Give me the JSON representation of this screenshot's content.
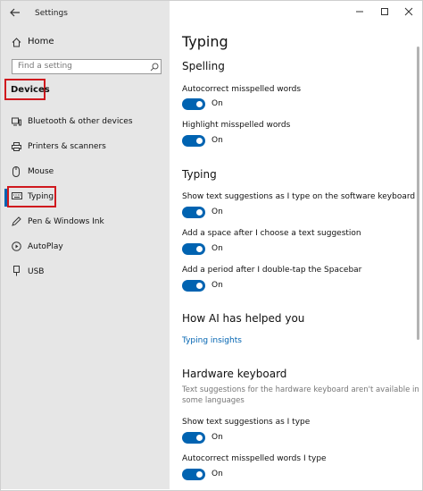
{
  "window": {
    "title": "Settings"
  },
  "sidebar": {
    "home_label": "Home",
    "search_placeholder": "Find a setting",
    "section_title": "Devices",
    "items": [
      {
        "label": "Bluetooth & other devices",
        "icon": "bluetooth-devices-icon"
      },
      {
        "label": "Printers & scanners",
        "icon": "printer-icon"
      },
      {
        "label": "Mouse",
        "icon": "mouse-icon"
      },
      {
        "label": "Typing",
        "icon": "keyboard-icon",
        "selected": true
      },
      {
        "label": "Pen & Windows Ink",
        "icon": "pen-icon"
      },
      {
        "label": "AutoPlay",
        "icon": "autoplay-icon"
      },
      {
        "label": "USB",
        "icon": "usb-icon"
      }
    ]
  },
  "main": {
    "page_title": "Typing",
    "spelling": {
      "heading": "Spelling",
      "autocorrect": {
        "label": "Autocorrect misspelled words",
        "state": "On"
      },
      "highlight": {
        "label": "Highlight misspelled words",
        "state": "On"
      }
    },
    "typing": {
      "heading": "Typing",
      "suggestions": {
        "label": "Show text suggestions as I type on the software keyboard",
        "state": "On"
      },
      "space": {
        "label": "Add a space after I choose a text suggestion",
        "state": "On"
      },
      "period": {
        "label": "Add a period after I double-tap the Spacebar",
        "state": "On"
      }
    },
    "ai": {
      "heading": "How AI has helped you",
      "link": "Typing insights"
    },
    "hardware": {
      "heading": "Hardware keyboard",
      "note_line1": "Text suggestions for the hardware keyboard aren't available in",
      "note_line2": "some languages",
      "suggestions": {
        "label": "Show text suggestions as I type",
        "state": "On"
      },
      "autocorrect": {
        "label": "Autocorrect misspelled words I type",
        "state": "On"
      }
    }
  },
  "colors": {
    "accent": "#0063b1",
    "highlight_box": "#d0191e",
    "sidebar_bg": "#e6e6e6"
  }
}
